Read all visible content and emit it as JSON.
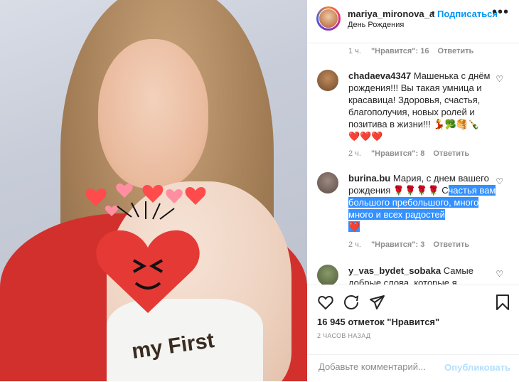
{
  "post": {
    "username": "mariya_mironova_a",
    "separator": "•",
    "follow_label": "Подписаться",
    "location": "День Рождения",
    "more_label": "•••",
    "onesie_text": "my First"
  },
  "comments": [
    {
      "meta_time": "1 ч.",
      "meta_likes": "\"Нравится\": 16",
      "meta_reply": "Ответить"
    },
    {
      "username": "chadaeva4347",
      "text": "Машенька с днём рождения!!! Вы такая умница и красавица! Здоровья, счастья, благополучия, новых ролей и позитива в жизни!!! 💃🥦🥞🍾",
      "emoji_line": "❤️❤️❤️",
      "meta_time": "2 ч.",
      "meta_likes": "\"Нравится\": 8",
      "meta_reply": "Ответить"
    },
    {
      "username": "burina.bu",
      "text_plain": "Мария, с днем вашего рождения 🌹🌹🌹🌹 С",
      "text_selected": "частья вам большого пребольшого, много много и всех радостей",
      "emoji_selected": "❤️",
      "meta_time": "2 ч.",
      "meta_likes": "\"Нравится\": 3",
      "meta_reply": "Ответить"
    },
    {
      "username": "y_vas_bydet_sobaka",
      "text": "Самые добрые слова, которые я"
    }
  ],
  "actions": {
    "likes_text": "16 945 отметок \"Нравится\"",
    "time_ago": "2 ЧАСОВ НАЗАД"
  },
  "add_comment": {
    "placeholder": "Добавьте комментарий...",
    "publish_label": "Опубликовать"
  },
  "colors": {
    "accent": "#0095f6",
    "publish_disabled": "#b2dffc",
    "selection": "#3390ff",
    "shirt": "#d2302c"
  },
  "icons": [
    "heart-icon",
    "comment-icon",
    "share-icon",
    "bookmark-icon",
    "more-icon"
  ]
}
